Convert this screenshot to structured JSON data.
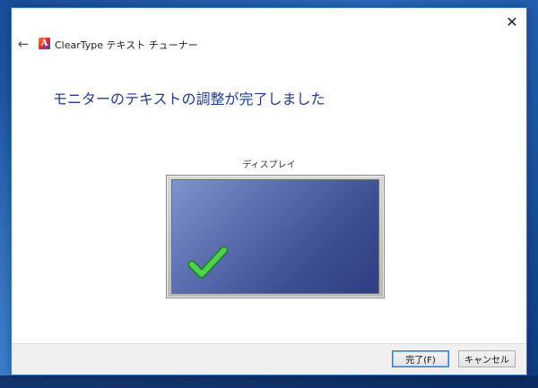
{
  "window": {
    "app_title": "ClearType テキスト チューナー",
    "close_icon": "✕",
    "back_icon": "←",
    "app_icon_letter": "A"
  },
  "content": {
    "heading": "モニターのテキストの調整が完了しました",
    "display_label": "ディスプレイ"
  },
  "footer": {
    "finish_label": "完了(F)",
    "cancel_label": "キャンセル"
  },
  "colors": {
    "heading": "#1f3a9c",
    "check": "#3cbc3c",
    "screen": "#4a5ea2"
  },
  "icons": [
    "back-arrow-icon",
    "cleartype-app-icon",
    "close-icon",
    "checkmark-icon"
  ]
}
